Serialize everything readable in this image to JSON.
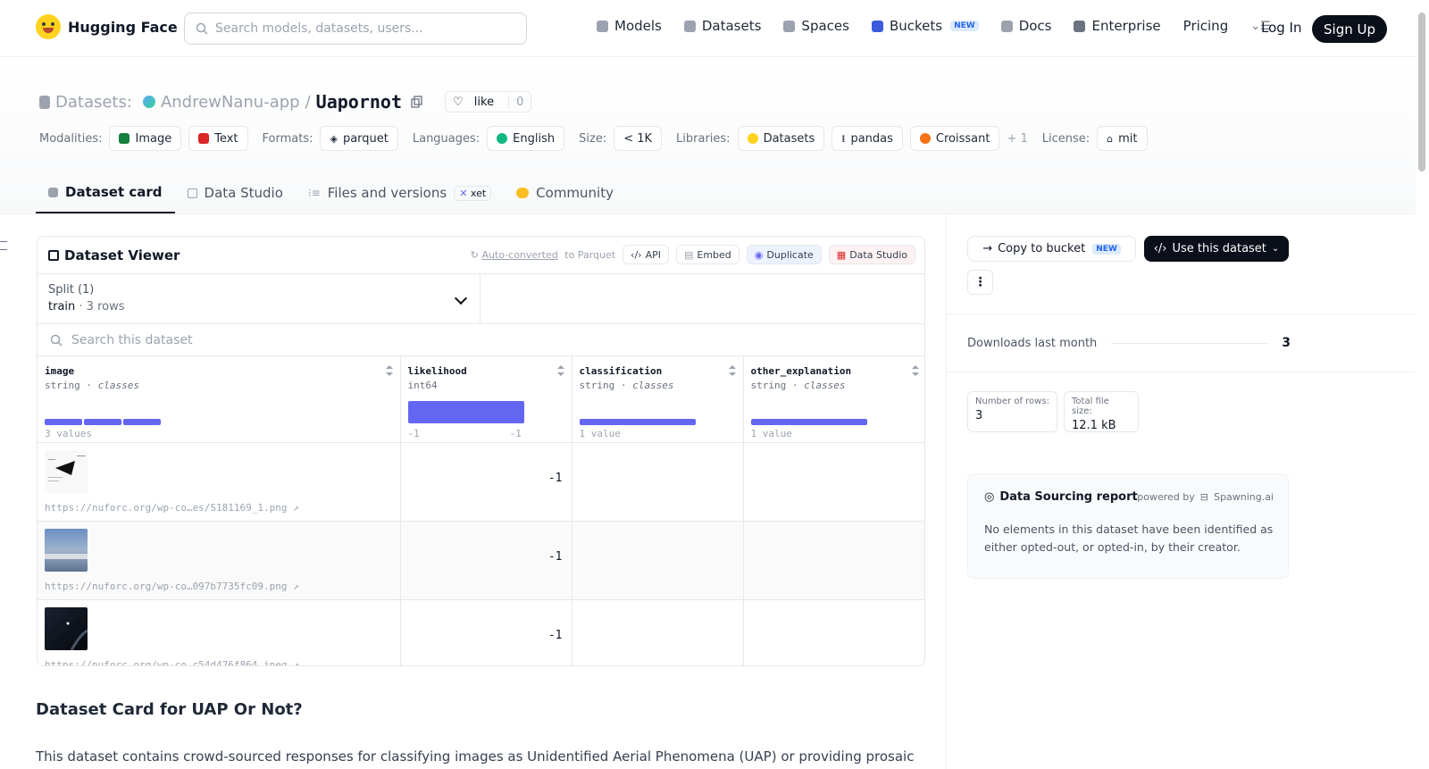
{
  "nav": {
    "brand": "Hugging Face",
    "search_placeholder": "Search models, datasets, users...",
    "items": [
      "Models",
      "Datasets",
      "Spaces",
      "Buckets",
      "Docs",
      "Enterprise",
      "Pricing"
    ],
    "new_badge": "NEW",
    "login": "Log In",
    "signup": "Sign Up"
  },
  "header": {
    "datasets_label": "Datasets:",
    "owner": "AndrewNanu-app",
    "separator": "/",
    "repo": "Uapornot",
    "like_label": "like",
    "like_count": "0",
    "modalities_label": "Modalities:",
    "modalities": [
      "Image",
      "Text"
    ],
    "formats_label": "Formats:",
    "format": "parquet",
    "languages_label": "Languages:",
    "language": "English",
    "size_label": "Size:",
    "size": "< 1K",
    "libraries_label": "Libraries:",
    "libraries": [
      "Datasets",
      "pandas",
      "Croissant"
    ],
    "libraries_more": "+ 1",
    "license_label": "License:",
    "license": "mit"
  },
  "tabs": {
    "card": "Dataset card",
    "studio": "Data Studio",
    "files": "Files and versions",
    "xet": "xet",
    "community": "Community"
  },
  "viewer": {
    "title": "Dataset Viewer",
    "auto_converted": "Auto-converted",
    "to_parquet": " to Parquet",
    "api": "API",
    "embed": "Embed",
    "duplicate": "Duplicate",
    "data_studio": "Data Studio",
    "split_label": "Split (1)",
    "split_name": "train",
    "split_rows": "3 rows",
    "search_placeholder": "Search this dataset",
    "columns": [
      {
        "name": "image",
        "type": "string",
        "kind": "classes",
        "stat": "3 values"
      },
      {
        "name": "likelihood",
        "type": "int64",
        "kind": "",
        "stat_min": "-1",
        "stat_max": "-1"
      },
      {
        "name": "classification",
        "type": "string",
        "kind": "classes",
        "stat": "1 value"
      },
      {
        "name": "other_explanation",
        "type": "string",
        "kind": "classes",
        "stat": "1 value"
      }
    ],
    "rows": [
      {
        "url": "https://nuforc.org/wp-co…es/S181169_1.png",
        "likelihood": "-1"
      },
      {
        "url": "https://nuforc.org/wp-co…097b7735fc09.png",
        "likelihood": "-1"
      },
      {
        "url": "https://nuforc.org/wp-co…c54d476f864.jpeg",
        "likelihood": "-1"
      }
    ]
  },
  "card": {
    "heading": "Dataset Card for UAP Or Not?",
    "intro": "This dataset contains crowd-sourced responses for classifying images as Unidentified Aerial Phenomena (UAP) or providing prosaic"
  },
  "sidebar": {
    "copy_to_bucket": "Copy to bucket",
    "new_badge": "NEW",
    "use_dataset": "Use this dataset",
    "downloads_label": "Downloads last month",
    "downloads_value": "3",
    "rows_label": "Number of rows:",
    "rows_value": "3",
    "size_label": "Total file size:",
    "size_value": "12.1 kB",
    "sourcing_title": "Data Sourcing report",
    "powered_by": "powered by",
    "spawning": "Spawning.ai",
    "sourcing_text": "No elements in this dataset have been identified as either opted-out, or opted-in, by their creator."
  },
  "colors": {
    "accent_bar": "#6366f1",
    "primary_button": "#0b0f19"
  }
}
